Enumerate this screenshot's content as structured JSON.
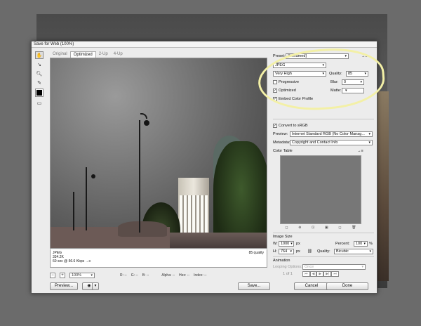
{
  "window": {
    "title": "Save for Web (100%)"
  },
  "tabs": [
    "Original",
    "Optimized",
    "2-Up",
    "4-Up"
  ],
  "preview_info": {
    "format": "JPEG",
    "size": "334.2K",
    "time": "60 sec @ 56.6 Kbps",
    "arrow": "→≡",
    "quality_note": "85 quality"
  },
  "statusbar": {
    "zoom": "100%",
    "r": "R: --",
    "g": "G: --",
    "b": "B: --",
    "alpha": "Alpha: --",
    "hex": "Hex: --",
    "index": "Index: --"
  },
  "buttons": {
    "preview": "Preview...",
    "save": "Save...",
    "cancel": "Cancel",
    "done": "Done"
  },
  "settings": {
    "preset_label": "Preset:",
    "preset_value": "[Unnamed]",
    "format": "JPEG",
    "compression": "Very High",
    "quality_label": "Quality:",
    "quality_value": "85",
    "progressive": "Progressive",
    "blur_label": "Blur:",
    "blur_value": "0",
    "optimized": "Optimized",
    "matte_label": "Matte:",
    "embed": "Embed Color Profile",
    "convert": "Convert to sRGB",
    "preview_label": "Preview:",
    "preview_value": "Internet Standard RGB (No Color Manag...",
    "metadata_label": "Metadata:",
    "metadata_value": "Copyright and Contact Info",
    "color_table": "Color Table",
    "menu_icon": "→≡"
  },
  "image_size": {
    "title": "Image Size",
    "w_label": "W:",
    "w_value": "1000",
    "h_label": "H:",
    "h_value": "764",
    "unit": "px",
    "percent_label": "Percent:",
    "percent_value": "100",
    "percent_unit": "%",
    "quality_label": "Quality:",
    "quality_value": "Bicubic"
  },
  "animation": {
    "title": "Animation",
    "looping_label": "Looping Options:",
    "looping_value": "Once",
    "frame": "1 of 1"
  }
}
